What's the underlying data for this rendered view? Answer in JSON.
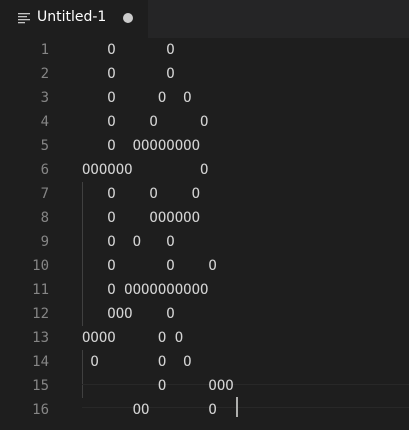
{
  "tab": {
    "title": "Untitled-1",
    "icon": "text-file-icon",
    "modified": true
  },
  "editor": {
    "lines": [
      {
        "number": "1",
        "text": "   O      O"
      },
      {
        "number": "2",
        "text": "   O      O"
      },
      {
        "number": "3",
        "text": "   O     O  O"
      },
      {
        "number": "4",
        "text": "   O    O     O"
      },
      {
        "number": "5",
        "text": "   O  OOOOOOOO"
      },
      {
        "number": "6",
        "text": "OOOOOO        O"
      },
      {
        "number": "7",
        "text": "   O    O    O"
      },
      {
        "number": "8",
        "text": "   O    OOOOOO"
      },
      {
        "number": "9",
        "text": "   O  O   O"
      },
      {
        "number": "10",
        "text": "   O      O    O"
      },
      {
        "number": "11",
        "text": "   O OOOOOOOOOO"
      },
      {
        "number": "12",
        "text": "   OOO    O"
      },
      {
        "number": "13",
        "text": "OOOO     O O"
      },
      {
        "number": "14",
        "text": " O       O  O"
      },
      {
        "number": "15",
        "text": "         O     OOO"
      },
      {
        "number": "16",
        "text": "      OO       O"
      }
    ]
  },
  "colors": {
    "background": "#1e1e1e",
    "tabbar": "#252526",
    "text": "#d4d4d4",
    "line_number": "#858585"
  }
}
